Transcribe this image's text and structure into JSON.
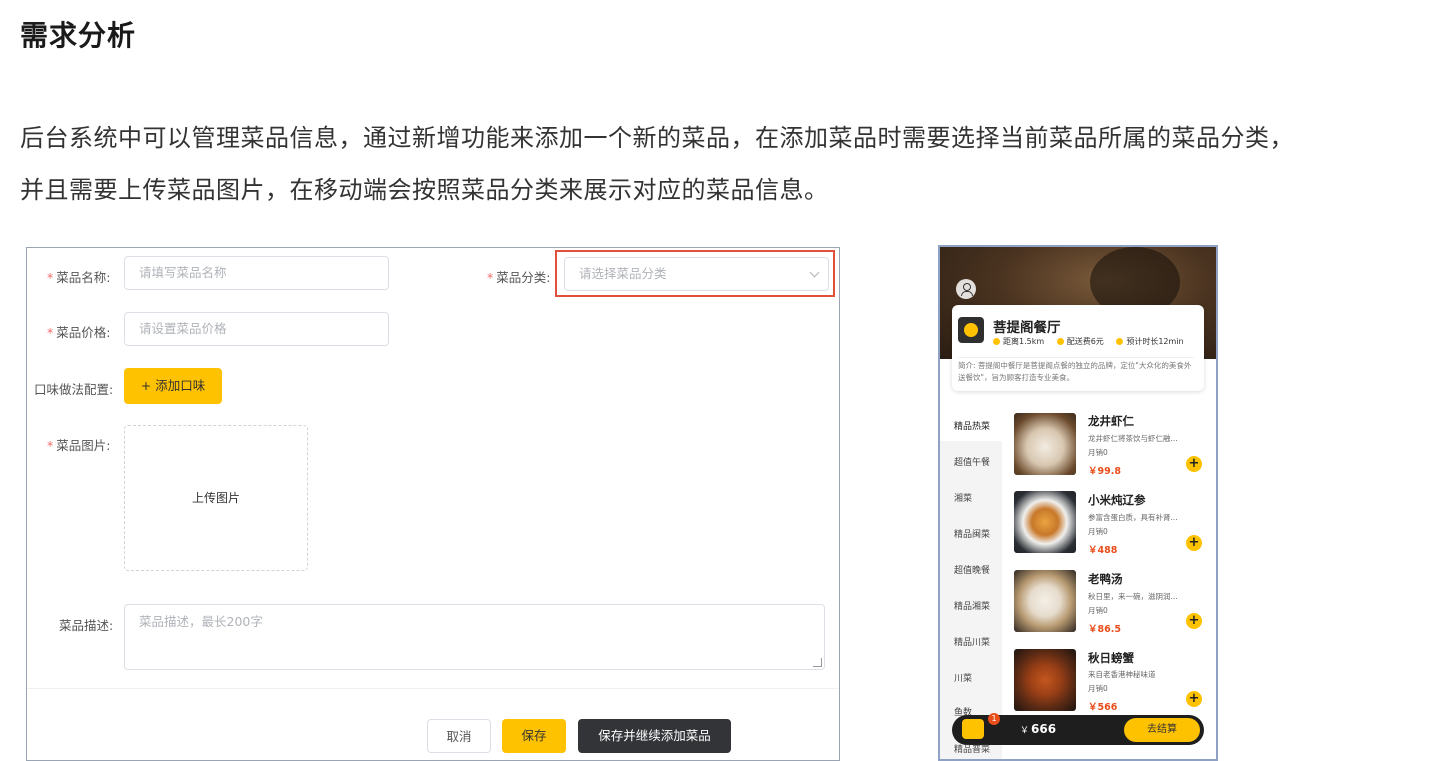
{
  "heading": "需求分析",
  "paragraph": {
    "line1": "后台系统中可以管理菜品信息，通过新增功能来添加一个新的菜品，在添加菜品时需要选择当前菜品所属的菜品分类，",
    "line2": "并且需要上传菜品图片，在移动端会按照菜品分类来展示对应的菜品信息。"
  },
  "form": {
    "required_mark": "*",
    "name_label": "菜品名称:",
    "name_placeholder": "请填写菜品名称",
    "category_label": "菜品分类:",
    "category_placeholder": "请选择菜品分类",
    "price_label": "菜品价格:",
    "price_placeholder": "请设置菜品价格",
    "flavor_label": "口味做法配置:",
    "add_flavor_button": "+ 添加口味",
    "image_label": "菜品图片:",
    "upload_text": "上传图片",
    "desc_label": "菜品描述:",
    "desc_placeholder": "菜品描述，最长200字",
    "cancel_button": "取消",
    "save_button": "保存",
    "save_continue_button": "保存并继续添加菜品"
  },
  "mobile": {
    "shop_name": "菩提阁餐厅",
    "meta": [
      "距离1.5km",
      "配送费6元",
      "预计时长12min"
    ],
    "intro": "简介: 菩提阁中餐厅是菩提阁点餐的独立的品牌，定位\"大众化的美食外送餐饮\"，旨为顾客打造专业美食。",
    "categories": [
      "精品热菜",
      "超值午餐",
      "湘菜",
      "精品闽菜",
      "超值晚餐",
      "精品湘菜",
      "精品川菜",
      "川菜",
      "鱼数"
    ],
    "partial_category": "精品普菜",
    "dishes": [
      {
        "name": "龙井虾仁",
        "desc": "龙井虾仁将茶饮与虾仁融...",
        "sales": "月销0",
        "price": "￥99.8"
      },
      {
        "name": "小米炖辽参",
        "desc": "参富含蛋白质，具有补肾...",
        "sales": "月销0",
        "price": "￥488"
      },
      {
        "name": "老鸭汤",
        "desc": "秋日里，来一碗，滋阴润...",
        "sales": "月销0",
        "price": "￥86.5"
      },
      {
        "name": "秋日螃蟹",
        "desc": "来自老香港神秘味道",
        "sales": "月销0",
        "price": "￥566"
      }
    ],
    "plus": "+",
    "cart_badge": "1",
    "cart_currency": "￥",
    "cart_total": "666",
    "checkout": "去结算"
  }
}
